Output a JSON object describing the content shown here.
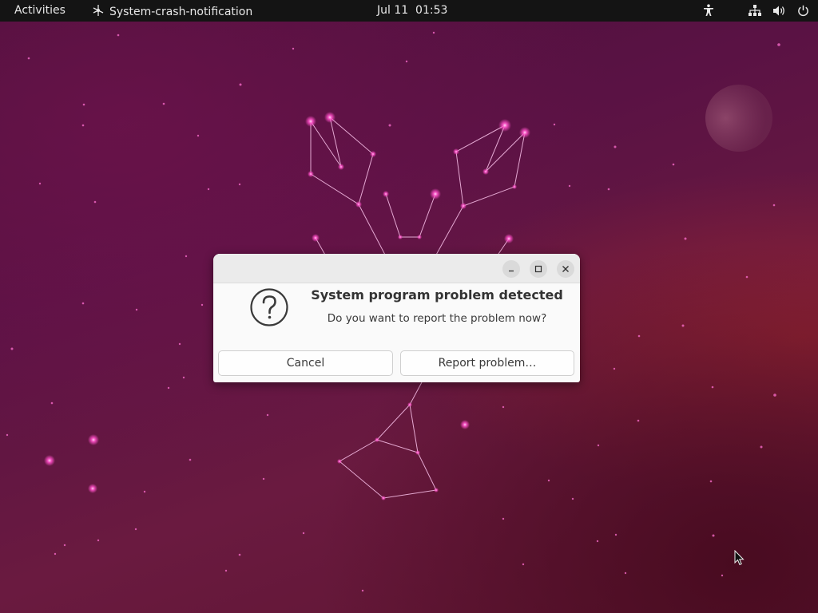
{
  "topbar": {
    "activities": "Activities",
    "app_name": "System-crash-notification",
    "clock": "Jul 11  01:53",
    "tray_icons": [
      "accessibility-icon",
      "network-icon",
      "volume-icon",
      "power-icon"
    ]
  },
  "dialog": {
    "window_controls": [
      "minimize",
      "maximize",
      "close"
    ],
    "icon": "question-icon",
    "heading": "System program problem detected",
    "message": "Do you want to report the problem now?",
    "buttons": {
      "cancel": "Cancel",
      "report": "Report problem…"
    }
  },
  "colors": {
    "topbar_bg": "#141414",
    "wallpaper_base": "#5a1244",
    "star_pink": "#ff4fc8",
    "dialog_bg": "#fafafa"
  }
}
